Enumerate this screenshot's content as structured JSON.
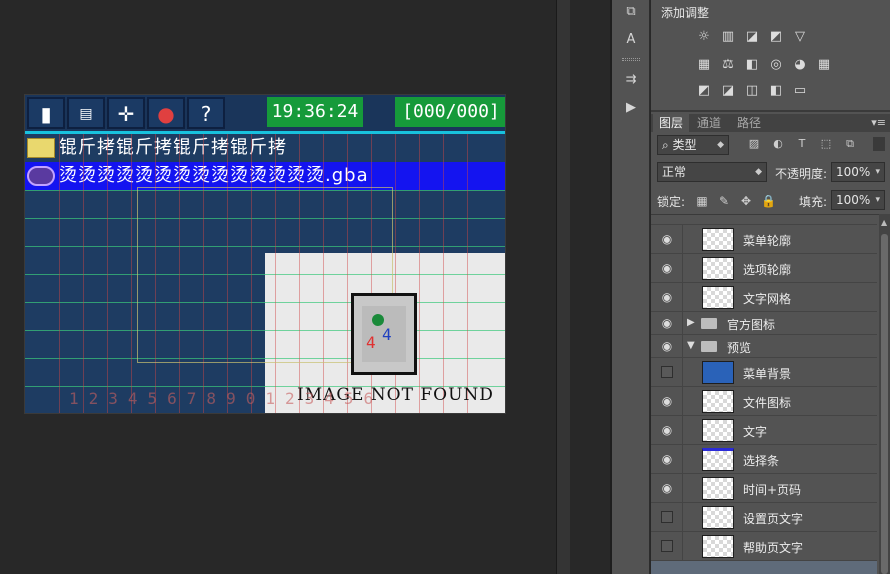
{
  "preview": {
    "time": "19:36:24",
    "page": "[000/000]",
    "folder_row": "锟斤拷锟斤拷锟斤拷锟斤拷",
    "file_row": "烫烫烫烫烫烫烫烫烫烫烫烫烫烫.gba",
    "not_found": "IMAGE NOT FOUND",
    "numbers": "1234567890123456"
  },
  "adjustments": {
    "title": "添加调整",
    "row1": [
      "☼",
      "▥",
      "◪",
      "◩",
      "▽"
    ],
    "row2": [
      "▦",
      "⚖",
      "◧",
      "◎",
      "◕",
      "▦"
    ],
    "row3": [
      "◩",
      "◪",
      "◫",
      "◧",
      "▭"
    ]
  },
  "tabs": [
    "图层",
    "通道",
    "路径"
  ],
  "filter": {
    "kind": "类型",
    "blend_mode": "正常",
    "opacity_label": "不透明度:",
    "opacity_value": "100%",
    "lock_label": "锁定:",
    "fill_label": "填充:",
    "fill_value": "100%"
  },
  "layers": [
    {
      "name": "菜单轮廓",
      "visible": true,
      "type": "layer"
    },
    {
      "name": "选项轮廓",
      "visible": true,
      "type": "layer"
    },
    {
      "name": "文字网格",
      "visible": true,
      "type": "layer"
    },
    {
      "name": "官方图标",
      "visible": true,
      "type": "group",
      "expanded": false
    },
    {
      "name": "预览",
      "visible": true,
      "type": "group",
      "expanded": true
    },
    {
      "name": "菜单背景",
      "visible": false,
      "type": "layer"
    },
    {
      "name": "文件图标",
      "visible": true,
      "type": "layer"
    },
    {
      "name": "文字",
      "visible": true,
      "type": "layer"
    },
    {
      "name": "选择条",
      "visible": true,
      "type": "layer"
    },
    {
      "name": "时间+页码",
      "visible": true,
      "type": "layer"
    },
    {
      "name": "设置页文字",
      "visible": false,
      "type": "layer"
    },
    {
      "name": "帮助页文字",
      "visible": false,
      "type": "layer"
    }
  ],
  "colors": {
    "panel_bg": "#535353",
    "canvas_bg": "#282828",
    "preview_bg": "#1e3c62",
    "selection_bar": "#1414f0",
    "status_green": "#169a3a"
  }
}
